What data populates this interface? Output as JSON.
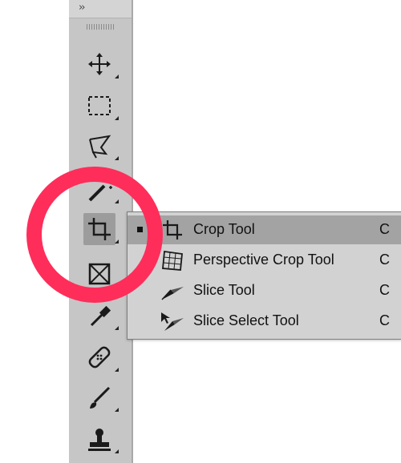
{
  "toolbar": {
    "collapse_glyph": "››",
    "tools": [
      {
        "name": "move-tool",
        "icon": "move-icon"
      },
      {
        "name": "marquee-tool",
        "icon": "marquee-icon"
      },
      {
        "name": "lasso-tool",
        "icon": "polygonal-lasso-icon"
      },
      {
        "name": "magic-wand-tool",
        "icon": "magic-wand-icon"
      },
      {
        "name": "crop-tool",
        "icon": "crop-icon",
        "active": true
      },
      {
        "name": "frame-tool",
        "icon": "frame-icon"
      },
      {
        "name": "eyedropper-tool",
        "icon": "eyedropper-icon"
      },
      {
        "name": "healing-brush-tool",
        "icon": "bandage-icon"
      },
      {
        "name": "brush-tool",
        "icon": "brush-icon"
      },
      {
        "name": "stamp-tool",
        "icon": "stamp-icon"
      }
    ]
  },
  "highlight": {
    "color": "#ff2d5a"
  },
  "flyout": {
    "items": [
      {
        "label": "Crop Tool",
        "shortcut": "C",
        "icon": "crop-icon",
        "selected": true
      },
      {
        "label": "Perspective Crop Tool",
        "shortcut": "C",
        "icon": "perspective-crop-icon"
      },
      {
        "label": "Slice Tool",
        "shortcut": "C",
        "icon": "slice-icon"
      },
      {
        "label": "Slice Select Tool",
        "shortcut": "C",
        "icon": "slice-select-icon"
      }
    ]
  }
}
